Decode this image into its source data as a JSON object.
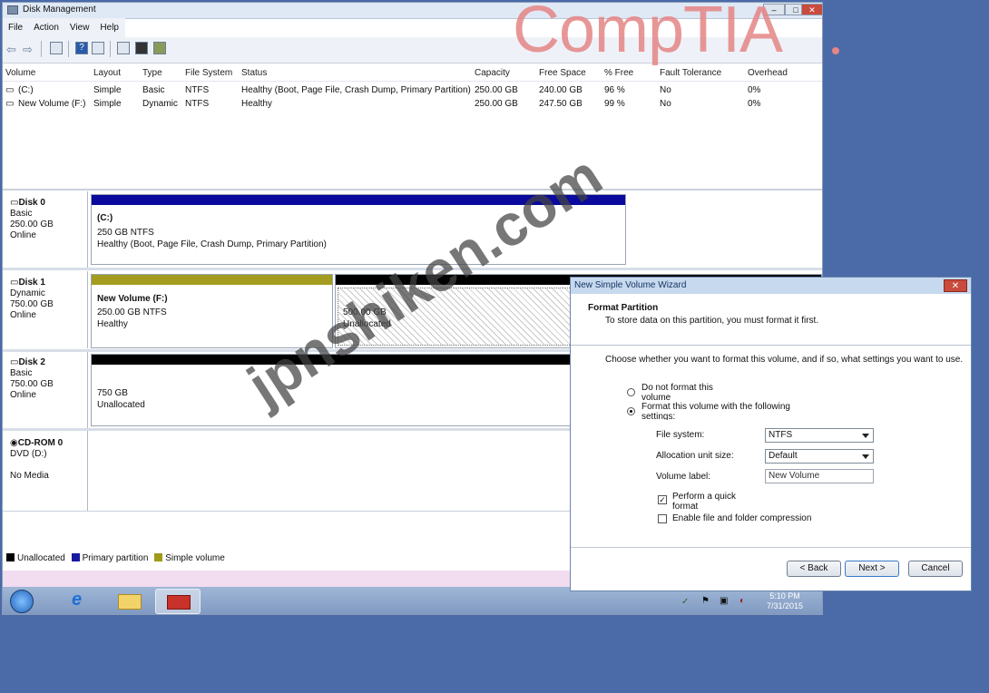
{
  "dm": {
    "title": "Disk Management",
    "menu": [
      "File",
      "Action",
      "View",
      "Help"
    ],
    "columns": [
      "Volume",
      "Layout",
      "Type",
      "File System",
      "Status",
      "Capacity",
      "Free Space",
      "% Free",
      "Fault Tolerance",
      "Overhead"
    ],
    "volumes": [
      {
        "name": "(C:)",
        "layout": "Simple",
        "type": "Basic",
        "fs": "NTFS",
        "status": "Healthy (Boot, Page File, Crash Dump, Primary Partition)",
        "capacity": "250.00 GB",
        "free": "240.00 GB",
        "pct": "96 %",
        "fault": "No",
        "overhead": "0%"
      },
      {
        "name": "New Volume (F:)",
        "layout": "Simple",
        "type": "Dynamic",
        "fs": "NTFS",
        "status": "Healthy",
        "capacity": "250.00 GB",
        "free": "247.50 GB",
        "pct": "99 %",
        "fault": "No",
        "overhead": "0%"
      }
    ],
    "disks": [
      {
        "name": "Disk 0",
        "kind": "Basic",
        "size": "250.00 GB",
        "state": "Online",
        "part": {
          "title": "(C:)",
          "line1": "250 GB NTFS",
          "line2": "Healthy (Boot, Page File, Crash Dump, Primary Partition)"
        }
      },
      {
        "name": "Disk 1",
        "kind": "Dynamic",
        "size": "750.00 GB",
        "state": "Online",
        "part": {
          "title": "New Volume (F:)",
          "line1": "250.00 GB NTFS",
          "line2": "Healthy"
        },
        "part2": {
          "line1": "500.00 GB",
          "line2": "Unallocated"
        }
      },
      {
        "name": "Disk 2",
        "kind": "Basic",
        "size": "750.00 GB",
        "state": "Online",
        "part": {
          "line1": "750 GB",
          "line2": "Unallocated"
        }
      },
      {
        "name": "CD-ROM 0",
        "kind": "DVD (D:)",
        "size": "",
        "state": "No Media"
      }
    ],
    "legend": [
      {
        "label": "Unallocated",
        "color": "#000000"
      },
      {
        "label": "Primary partition",
        "color": "#1a1aa0"
      },
      {
        "label": "Simple volume",
        "color": "#a09a18"
      }
    ],
    "colors": {
      "primary": "#0a0a9c",
      "simple": "#a39c1e",
      "unallocated": "#000000"
    }
  },
  "taskbar": {
    "time": "5:10 PM",
    "date": "7/31/2015"
  },
  "wizard": {
    "title": "New Simple Volume Wizard",
    "heading": "Format Partition",
    "subheading": "To store data on this partition, you must format it first.",
    "question": "Choose whether you want to format this volume, and if so, what settings you want to use.",
    "opt_no": "Do not format this volume",
    "opt_yes": "Format this volume with the following settings:",
    "fs_label": "File system:",
    "fs_value": "NTFS",
    "alloc_label": "Allocation unit size:",
    "alloc_value": "Default",
    "vlabel_label": "Volume label:",
    "vlabel_value": "New Volume",
    "quick": "Perform a quick format",
    "compress": "Enable file and folder compression",
    "back": "< Back",
    "next": "Next >",
    "cancel": "Cancel"
  },
  "overlays": {
    "logo": "CompTIA",
    "watermark": "jpnshiken.com"
  }
}
